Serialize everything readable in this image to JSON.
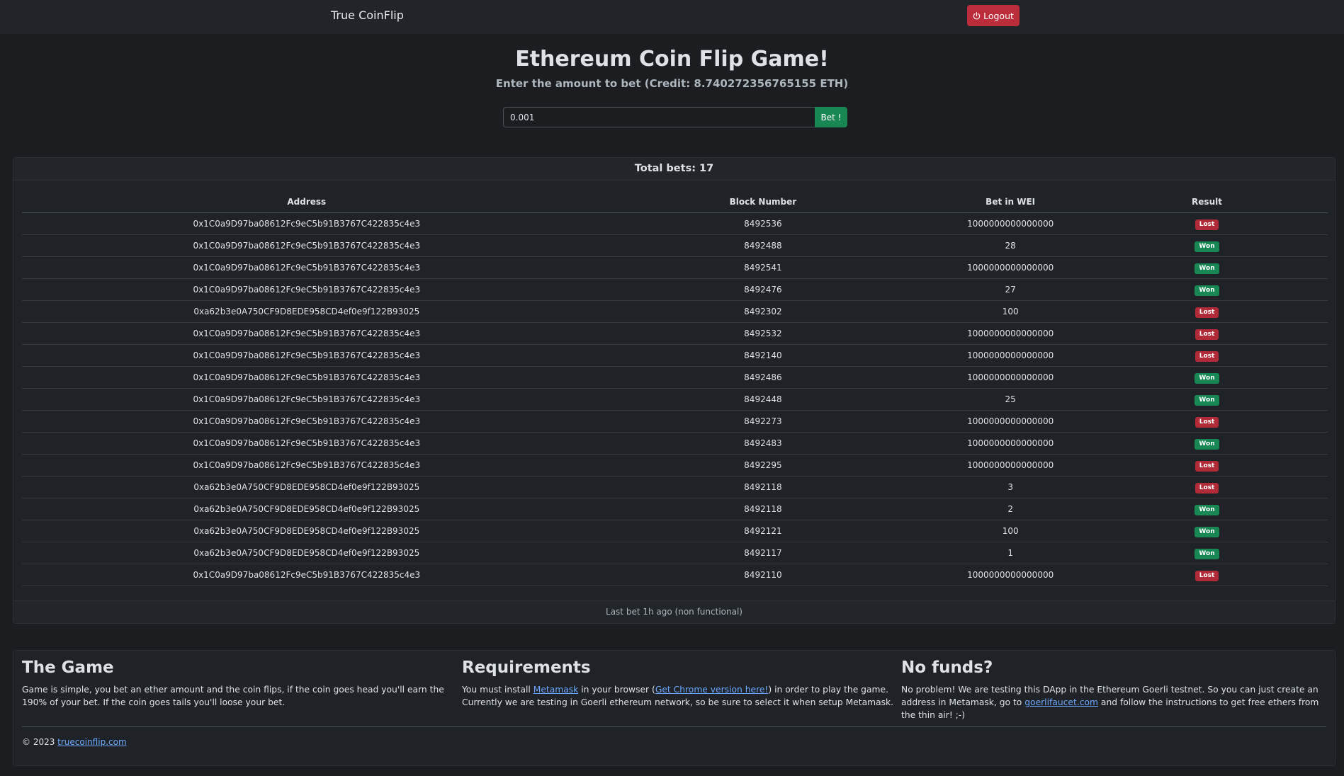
{
  "navbar": {
    "brand": "True CoinFlip",
    "logout_label": "Logout"
  },
  "hero": {
    "title": "Ethereum Coin Flip Game!",
    "subtitle": "Enter the amount to bet (Credit: 8.740272356765155 ETH)"
  },
  "bet_form": {
    "value": "0.001",
    "button_label": "Bet !"
  },
  "bets": {
    "total_label": "Total bets: 17",
    "columns": [
      "Address",
      "Block Number",
      "Bet in WEI",
      "Result"
    ],
    "rows": [
      {
        "address": "0x1C0a9D97ba08612Fc9eC5b91B3767C422835c4e3",
        "block": "8492536",
        "bet": "1000000000000000",
        "result": "Lost"
      },
      {
        "address": "0x1C0a9D97ba08612Fc9eC5b91B3767C422835c4e3",
        "block": "8492488",
        "bet": "28",
        "result": "Won"
      },
      {
        "address": "0x1C0a9D97ba08612Fc9eC5b91B3767C422835c4e3",
        "block": "8492541",
        "bet": "1000000000000000",
        "result": "Won"
      },
      {
        "address": "0x1C0a9D97ba08612Fc9eC5b91B3767C422835c4e3",
        "block": "8492476",
        "bet": "27",
        "result": "Won"
      },
      {
        "address": "0xa62b3e0A750CF9D8EDE958CD4ef0e9f122B93025",
        "block": "8492302",
        "bet": "100",
        "result": "Lost"
      },
      {
        "address": "0x1C0a9D97ba08612Fc9eC5b91B3767C422835c4e3",
        "block": "8492532",
        "bet": "1000000000000000",
        "result": "Lost"
      },
      {
        "address": "0x1C0a9D97ba08612Fc9eC5b91B3767C422835c4e3",
        "block": "8492140",
        "bet": "1000000000000000",
        "result": "Lost"
      },
      {
        "address": "0x1C0a9D97ba08612Fc9eC5b91B3767C422835c4e3",
        "block": "8492486",
        "bet": "1000000000000000",
        "result": "Won"
      },
      {
        "address": "0x1C0a9D97ba08612Fc9eC5b91B3767C422835c4e3",
        "block": "8492448",
        "bet": "25",
        "result": "Won"
      },
      {
        "address": "0x1C0a9D97ba08612Fc9eC5b91B3767C422835c4e3",
        "block": "8492273",
        "bet": "1000000000000000",
        "result": "Lost"
      },
      {
        "address": "0x1C0a9D97ba08612Fc9eC5b91B3767C422835c4e3",
        "block": "8492483",
        "bet": "1000000000000000",
        "result": "Won"
      },
      {
        "address": "0x1C0a9D97ba08612Fc9eC5b91B3767C422835c4e3",
        "block": "8492295",
        "bet": "1000000000000000",
        "result": "Lost"
      },
      {
        "address": "0xa62b3e0A750CF9D8EDE958CD4ef0e9f122B93025",
        "block": "8492118",
        "bet": "3",
        "result": "Lost"
      },
      {
        "address": "0xa62b3e0A750CF9D8EDE958CD4ef0e9f122B93025",
        "block": "8492118",
        "bet": "2",
        "result": "Won"
      },
      {
        "address": "0xa62b3e0A750CF9D8EDE958CD4ef0e9f122B93025",
        "block": "8492121",
        "bet": "100",
        "result": "Won"
      },
      {
        "address": "0xa62b3e0A750CF9D8EDE958CD4ef0e9f122B93025",
        "block": "8492117",
        "bet": "1",
        "result": "Won"
      },
      {
        "address": "0x1C0a9D97ba08612Fc9eC5b91B3767C422835c4e3",
        "block": "8492110",
        "bet": "1000000000000000",
        "result": "Lost"
      }
    ],
    "footer": "Last bet 1h ago (non functional)"
  },
  "info": {
    "game": {
      "title": "The Game",
      "text": "Game is simple, you bet an ether amount and the coin flips, if the coin goes head you'll earn the 190% of your bet. If the coin goes tails you'll loose your bet."
    },
    "requirements": {
      "title": "Requirements",
      "text_1": "You must install ",
      "link_metamask": "Metamask",
      "text_2": " in your browser (",
      "link_chrome": "Get Chrome version here!",
      "text_3": ") in order to play the game. Currently we are testing in Goerli ethereum network, so be sure to select it when setup Metamask."
    },
    "nofunds": {
      "title": "No funds?",
      "text_1": "No problem! We are testing this DApp in the Ethereum Goerli testnet. So you can just create an address in Metamask, go to ",
      "link_faucet": "goerlifaucet.com",
      "text_2": " and follow the instructions to get free ethers from the thin air! ;-)"
    },
    "copyright_prefix": "© 2023 ",
    "copyright_link": "truecoinflip.com"
  },
  "icons": {
    "logout": "power-icon"
  },
  "colors": {
    "lost": "#b02a37",
    "won": "#198754",
    "logout": "#bb2d3b"
  }
}
